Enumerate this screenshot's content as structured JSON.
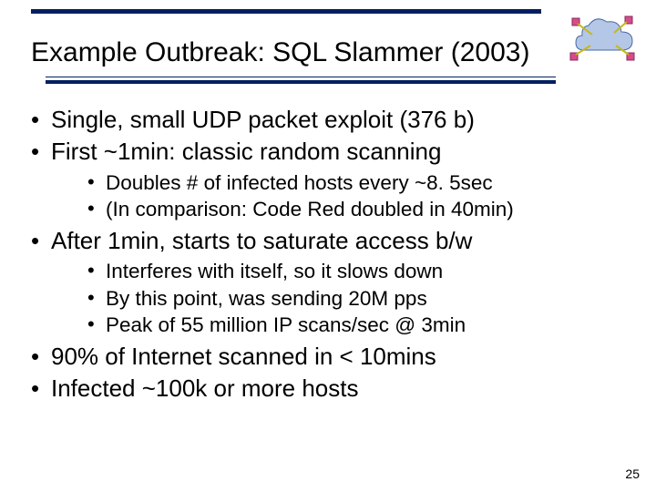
{
  "title": "Example Outbreak: SQL Slammer (2003)",
  "bullets": [
    {
      "text": "Single, small UDP packet exploit (376 b)",
      "sub": []
    },
    {
      "text": "First ~1min:  classic random scanning",
      "sub": [
        "Doubles # of infected hosts every ~8. 5sec",
        "(In comparison:  Code Red doubled in 40min)"
      ]
    },
    {
      "text": "After 1min, starts to saturate access b/w",
      "sub": [
        "Interferes with itself, so it slows down",
        "By this point, was sending 20M pps",
        "Peak of 55 million IP scans/sec @ 3min"
      ]
    },
    {
      "text": "90% of Internet scanned in < 10mins",
      "sub": []
    },
    {
      "text": "Infected ~100k or more hosts",
      "sub": []
    }
  ],
  "page_number": "25"
}
